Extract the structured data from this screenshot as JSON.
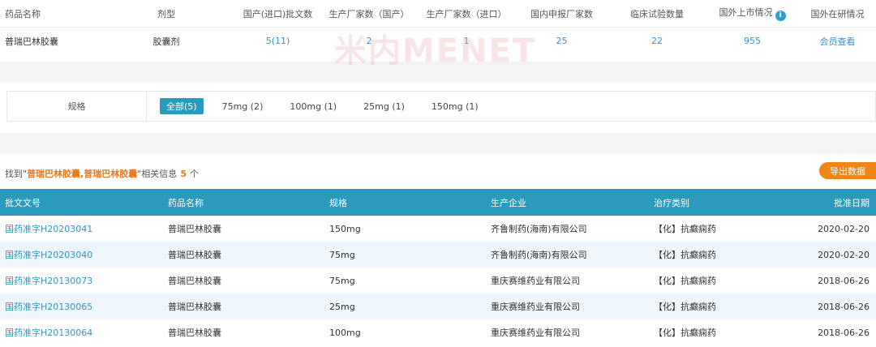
{
  "summary": {
    "headers": [
      "药品名称",
      "剂型",
      "国产(进口)批文数",
      "生产厂家数（国产）",
      "生产厂家数（进口）",
      "国内申报厂家数",
      "临床试验数量",
      "国外上市情况",
      "国外在研情况"
    ],
    "row": {
      "name": "普瑞巴林胶囊",
      "form": "胶囊剂",
      "approvals": "5(11)",
      "domestic_mfr": "2",
      "import_mfr": "1",
      "domestic_apply": "25",
      "clinical_trials": "22",
      "foreign_market": "955",
      "foreign_research": "会员查看"
    }
  },
  "watermark": "米内MENET",
  "spec_filter": {
    "label": "规格",
    "options": [
      "全部(5)",
      "75mg (2)",
      "100mg (1)",
      "25mg (1)",
      "150mg (1)"
    ]
  },
  "results": {
    "found_prefix": "找到\"",
    "keyword": "普瑞巴林胶囊,普瑞巴林胶囊",
    "found_mid": "\"相关信息",
    "count": "5",
    "found_suffix": "个",
    "export_label": "导出数据",
    "columns": [
      "批文文号",
      "药品名称",
      "规格",
      "生产企业",
      "治疗类别",
      "批准日期"
    ],
    "rows": [
      {
        "approval": "国药准字H20203041",
        "name": "普瑞巴林胶囊",
        "spec": "150mg",
        "company": "齐鲁制药(海南)有限公司",
        "category": "【化】抗癫痫药",
        "date": "2020-02-20"
      },
      {
        "approval": "国药准字H20203040",
        "name": "普瑞巴林胶囊",
        "spec": "75mg",
        "company": "齐鲁制药(海南)有限公司",
        "category": "【化】抗癫痫药",
        "date": "2020-02-20"
      },
      {
        "approval": "国药准字H20130073",
        "name": "普瑞巴林胶囊",
        "spec": "75mg",
        "company": "重庆赛维药业有限公司",
        "category": "【化】抗癫痫药",
        "date": "2018-06-26"
      },
      {
        "approval": "国药准字H20130065",
        "name": "普瑞巴林胶囊",
        "spec": "25mg",
        "company": "重庆赛维药业有限公司",
        "category": "【化】抗癫痫药",
        "date": "2018-06-26"
      },
      {
        "approval": "国药准字H20130064",
        "name": "普瑞巴林胶囊",
        "spec": "100mg",
        "company": "重庆赛维药业有限公司",
        "category": "【化】抗癫痫药",
        "date": "2018-06-26"
      }
    ]
  },
  "colors": {
    "header_teal": "#2a9bbd",
    "link_blue": "#3d8fd1",
    "accent_orange": "#ef8516",
    "info_icon": "#2f9fd1"
  },
  "icons": {
    "foreign_market_info": "info-circle-icon"
  }
}
